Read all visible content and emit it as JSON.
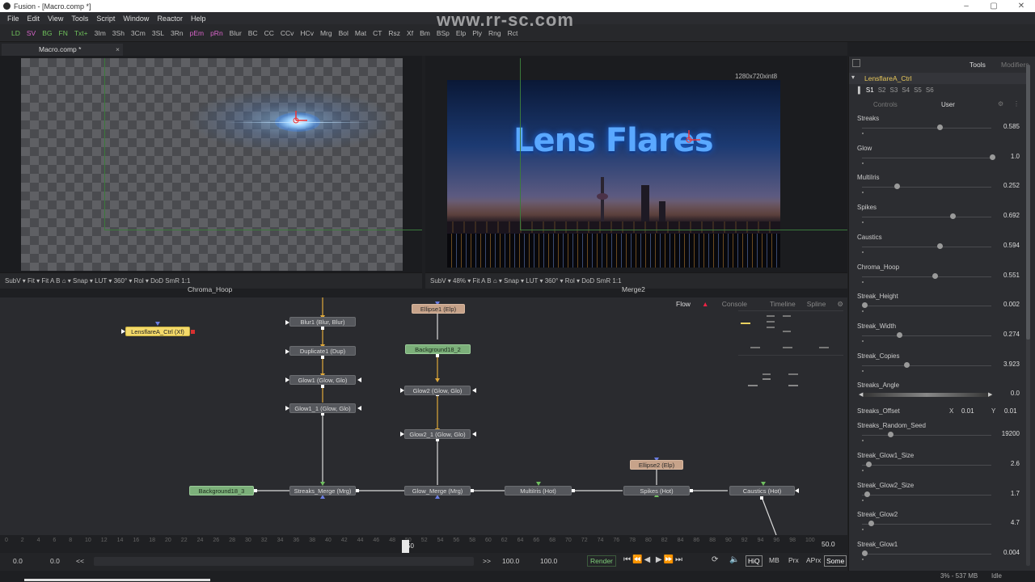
{
  "window": {
    "title": "Fusion - [Macro.comp *]"
  },
  "watermark": "www.rr-sc.com",
  "menu": [
    "File",
    "Edit",
    "View",
    "Tools",
    "Script",
    "Window",
    "Reactor",
    "Help"
  ],
  "toolbar": [
    {
      "label": "LD",
      "color": "#6fc25b"
    },
    {
      "label": "SV",
      "color": "#d764c9"
    },
    {
      "label": "BG",
      "color": "#6fc25b"
    },
    {
      "label": "FN",
      "color": "#6fc25b"
    },
    {
      "label": "Txt+",
      "color": "#6fc25b"
    },
    {
      "label": "3Im",
      "color": "#bbbbbb"
    },
    {
      "label": "3Sh",
      "color": "#bbbbbb"
    },
    {
      "label": "3Cm",
      "color": "#bbbbbb"
    },
    {
      "label": "3SL",
      "color": "#bbbbbb"
    },
    {
      "label": "3Rn",
      "color": "#bbbbbb"
    },
    {
      "label": "pEm",
      "color": "#d764c9"
    },
    {
      "label": "pRn",
      "color": "#d764c9"
    },
    {
      "label": "Blur",
      "color": "#bbbbbb"
    },
    {
      "label": "BC",
      "color": "#bbbbbb"
    },
    {
      "label": "CC",
      "color": "#bbbbbb"
    },
    {
      "label": "CCv",
      "color": "#bbbbbb"
    },
    {
      "label": "HCv",
      "color": "#bbbbbb"
    },
    {
      "label": "Mrg",
      "color": "#bbbbbb"
    },
    {
      "label": "Bol",
      "color": "#bbbbbb"
    },
    {
      "label": "Mat",
      "color": "#bbbbbb"
    },
    {
      "label": "CT",
      "color": "#bbbbbb"
    },
    {
      "label": "Rsz",
      "color": "#bbbbbb"
    },
    {
      "label": "Xf",
      "color": "#bbbbbb"
    },
    {
      "label": "Bm",
      "color": "#bbbbbb"
    },
    {
      "label": "BSp",
      "color": "#bbbbbb"
    },
    {
      "label": "Elp",
      "color": "#bbbbbb"
    },
    {
      "label": "Ply",
      "color": "#bbbbbb"
    },
    {
      "label": "Rng",
      "color": "#bbbbbb"
    },
    {
      "label": "Rct",
      "color": "#bbbbbb"
    }
  ],
  "doc_tab": {
    "label": "Macro.comp *",
    "close": "×"
  },
  "viewer1": {
    "name": "Chroma_Hoop",
    "bar": "SubV ▾   Fit ▾   Fit         A  B  ⌂ ▾ Snap ▾       LUT ▾   360° ▾  Rol ▾  DoD        SmR  1:1"
  },
  "viewer2": {
    "name": "Merge2",
    "resolution": "1280x720xint8",
    "title_text": "Lens Flares",
    "bar": "SubV ▾   48% ▾   Fit         A  B  ⌂ ▾ Snap ▾       LUT ▾   360° ▾  Rol ▾  DoD        SmR  1:1"
  },
  "flow_tabs": [
    "Flow",
    "Console",
    "Timeline",
    "Spline"
  ],
  "nodes": [
    {
      "id": "n1",
      "label": "LensflareA_Ctrl  (Xf)"
    },
    {
      "id": "n2",
      "label": "Blur1  (Blur, Blur)"
    },
    {
      "id": "n3",
      "label": "Duplicate1  (Dup)"
    },
    {
      "id": "n4",
      "label": "Glow1  (Glow, Glo)"
    },
    {
      "id": "n5",
      "label": "Glow1_1  (Glow, Glo)"
    },
    {
      "id": "n6",
      "label": "Ellipse1  (Elp)"
    },
    {
      "id": "n7",
      "label": "Background18_2"
    },
    {
      "id": "n8",
      "label": "Glow2  (Glow, Glo)"
    },
    {
      "id": "n9",
      "label": "Glow2_1  (Glow, Glo)"
    },
    {
      "id": "n10",
      "label": "Background18_3"
    },
    {
      "id": "n11",
      "label": "Streaks_Merge  (Mrg)"
    },
    {
      "id": "n12",
      "label": "Glow_Merge  (Mrg)"
    },
    {
      "id": "n13",
      "label": "MultiIris  (Hot)"
    },
    {
      "id": "n14",
      "label": "Spikes  (Hot)"
    },
    {
      "id": "n15",
      "label": "Caustics  (Hot)"
    },
    {
      "id": "n16",
      "label": "Ellipse2  (Elp)"
    }
  ],
  "timeline": {
    "ticks": [
      "0",
      "2",
      "4",
      "6",
      "8",
      "10",
      "12",
      "14",
      "16",
      "18",
      "20",
      "22",
      "24",
      "26",
      "28",
      "30",
      "32",
      "34",
      "36",
      "38",
      "40",
      "42",
      "44",
      "46",
      "48",
      "50",
      "52",
      "54",
      "56",
      "58",
      "60",
      "62",
      "64",
      "66",
      "68",
      "70",
      "72",
      "74",
      "76",
      "78",
      "80",
      "82",
      "84",
      "86",
      "88",
      "90",
      "92",
      "94",
      "96",
      "98",
      "100"
    ],
    "current": "50",
    "end_frame": "50.0"
  },
  "transport": {
    "start": "0.0",
    "render_start": "0.0",
    "back": "<<",
    "fwd": ">>",
    "render_end": "100.0",
    "end": "100.0",
    "render": "Render",
    "buttons": [
      "HiQ",
      "MB",
      "Prx",
      "APrx",
      "Some"
    ]
  },
  "status": {
    "memory": "3% - 537 MB",
    "state": "Idle"
  },
  "inspector": {
    "tabs": [
      "Tools",
      "Modifiers"
    ],
    "tool_name": "LensflareA_Ctrl",
    "versions": [
      "S1",
      "S2",
      "S3",
      "S4",
      "S5",
      "S6"
    ],
    "subtabs": [
      "Controls",
      "User"
    ],
    "params": [
      {
        "label": "Streaks",
        "value": "0.585",
        "level": 0.59
      },
      {
        "label": "Glow",
        "value": "1.0",
        "level": 1.0
      },
      {
        "label": "MultiIris",
        "value": "0.252",
        "level": 0.25
      },
      {
        "label": "Spikes",
        "value": "0.692",
        "level": 0.69
      },
      {
        "label": "Caustics",
        "value": "0.594",
        "level": 0.59
      },
      {
        "label": "Chroma_Hoop",
        "value": "0.551",
        "level": 0.55
      },
      {
        "label": "Streak_Height",
        "value": "0.002",
        "level": 0.0
      },
      {
        "label": "Streak_Width",
        "value": "0.274",
        "level": 0.27
      },
      {
        "label": "Streak_Copies",
        "value": "3.923",
        "level": 0.33
      },
      {
        "label": "Streaks_Angle",
        "value": "0.0",
        "level": 0.5
      },
      {
        "label": "Streaks_Random_Seed",
        "value": "19200",
        "level": 0.2
      },
      {
        "label": "Streak_Glow1_Size",
        "value": "2.6",
        "level": 0.03
      },
      {
        "label": "Streak_Glow2_Size",
        "value": "1.7",
        "level": 0.02
      },
      {
        "label": "Streak_Glow2",
        "value": "4.7",
        "level": 0.05
      },
      {
        "label": "Streak_Glow1",
        "value": "0.004",
        "level": 0.0
      }
    ],
    "offset": {
      "label": "Streaks_Offset",
      "x_label": "X",
      "x": "0.01",
      "y_label": "Y",
      "y": "0.01"
    }
  }
}
